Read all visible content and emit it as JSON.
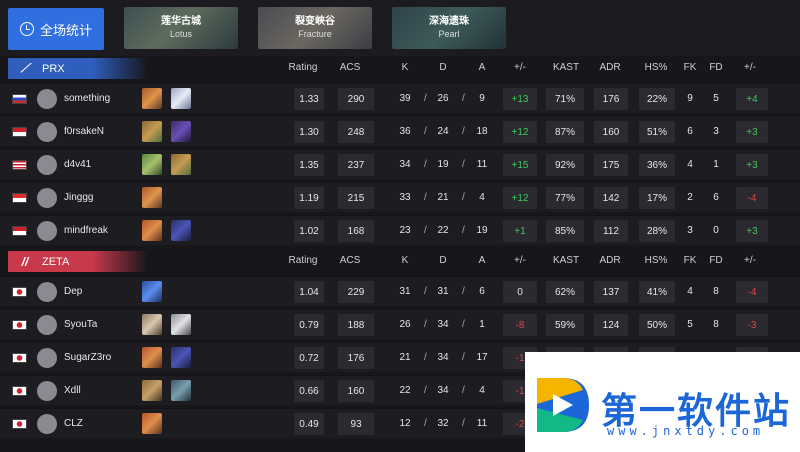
{
  "overall_button": {
    "label": "全场统计",
    "icon": "stats-pie-icon"
  },
  "maps": [
    {
      "cn": "莲华古城",
      "en": "Lotus"
    },
    {
      "cn": "裂变峡谷",
      "en": "Fracture"
    },
    {
      "cn": "深海遗珠",
      "en": "Pearl"
    }
  ],
  "columns": {
    "rating": "Rating",
    "acs": "ACS",
    "k": "K",
    "d": "D",
    "a": "A",
    "pm": "+/-",
    "kast": "KAST",
    "adr": "ADR",
    "hs": "HS%",
    "fk": "FK",
    "fd": "FD",
    "fpm": "+/-"
  },
  "colors": {
    "prx": "#2f5ebc",
    "zeta": "#c9394c",
    "positive": "#3ec85a",
    "negative": "#e04545"
  },
  "teams": [
    {
      "name": "PRX",
      "players": [
        {
          "name": "something",
          "flag": "russia",
          "agents": [
            "raze",
            "jett"
          ],
          "rating": "1.33",
          "acs": "290",
          "k": "39",
          "d": "26",
          "a": "9",
          "pm": "+13",
          "kast": "71%",
          "adr": "176",
          "hs": "22%",
          "fk": "9",
          "fd": "5",
          "fpm": "+4"
        },
        {
          "name": "f0rsakeN",
          "flag": "indonesia",
          "agents": [
            "gekko",
            "reyna"
          ],
          "rating": "1.30",
          "acs": "248",
          "k": "36",
          "d": "24",
          "a": "18",
          "pm": "+12",
          "kast": "87%",
          "adr": "160",
          "hs": "51%",
          "fk": "6",
          "fd": "3",
          "fpm": "+3"
        },
        {
          "name": "d4v41",
          "flag": "malaysia",
          "agents": [
            "skye",
            "gekko"
          ],
          "rating": "1.35",
          "acs": "237",
          "k": "34",
          "d": "19",
          "a": "11",
          "pm": "+15",
          "kast": "92%",
          "adr": "175",
          "hs": "36%",
          "fk": "4",
          "fd": "1",
          "fpm": "+3"
        },
        {
          "name": "Jinggg",
          "flag": "singapore",
          "agents": [
            "raze"
          ],
          "rating": "1.19",
          "acs": "215",
          "k": "33",
          "d": "21",
          "a": "4",
          "pm": "+12",
          "kast": "77%",
          "adr": "142",
          "hs": "17%",
          "fk": "2",
          "fd": "6",
          "fpm": "-4"
        },
        {
          "name": "mindfreak",
          "flag": "indonesia",
          "agents": [
            "breach",
            "omen"
          ],
          "rating": "1.02",
          "acs": "168",
          "k": "23",
          "d": "22",
          "a": "19",
          "pm": "+1",
          "kast": "85%",
          "adr": "112",
          "hs": "28%",
          "fk": "3",
          "fd": "0",
          "fpm": "+3"
        }
      ]
    },
    {
      "name": "ZETA",
      "players": [
        {
          "name": "Dep",
          "flag": "japan",
          "agents": [
            "neon"
          ],
          "rating": "1.04",
          "acs": "229",
          "k": "31",
          "d": "31",
          "a": "6",
          "pm": "0",
          "kast": "62%",
          "adr": "137",
          "hs": "41%",
          "fk": "4",
          "fd": "8",
          "fpm": "-4"
        },
        {
          "name": "SyouTa",
          "flag": "japan",
          "agents": [
            "chamber",
            "cypher"
          ],
          "rating": "0.79",
          "acs": "188",
          "k": "26",
          "d": "34",
          "a": "1",
          "pm": "-8",
          "kast": "59%",
          "adr": "124",
          "hs": "50%",
          "fk": "5",
          "fd": "8",
          "fpm": "-3"
        },
        {
          "name": "SugarZ3ro",
          "flag": "japan",
          "agents": [
            "breach",
            "omen"
          ],
          "rating": "0.72",
          "acs": "176",
          "k": "21",
          "d": "34",
          "a": "17",
          "pm": "-1",
          "kast": "",
          "adr": "",
          "hs": "",
          "fk": "",
          "fd": "",
          "fpm": ""
        },
        {
          "name": "Xdll",
          "flag": "japan",
          "agents": [
            "sova",
            "harbor"
          ],
          "rating": "0.66",
          "acs": "160",
          "k": "22",
          "d": "34",
          "a": "4",
          "pm": "-1",
          "kast": "",
          "adr": "",
          "hs": "",
          "fk": "",
          "fd": "",
          "fpm": ""
        },
        {
          "name": "CLZ",
          "flag": "japan",
          "agents": [
            "breach"
          ],
          "rating": "0.49",
          "acs": "93",
          "k": "12",
          "d": "32",
          "a": "11",
          "pm": "-2",
          "kast": "",
          "adr": "",
          "hs": "",
          "fk": "",
          "fd": "",
          "fpm": ""
        }
      ]
    }
  ],
  "watermark": {
    "title": "第一软件站",
    "url": "www.jnxtdy.com"
  }
}
